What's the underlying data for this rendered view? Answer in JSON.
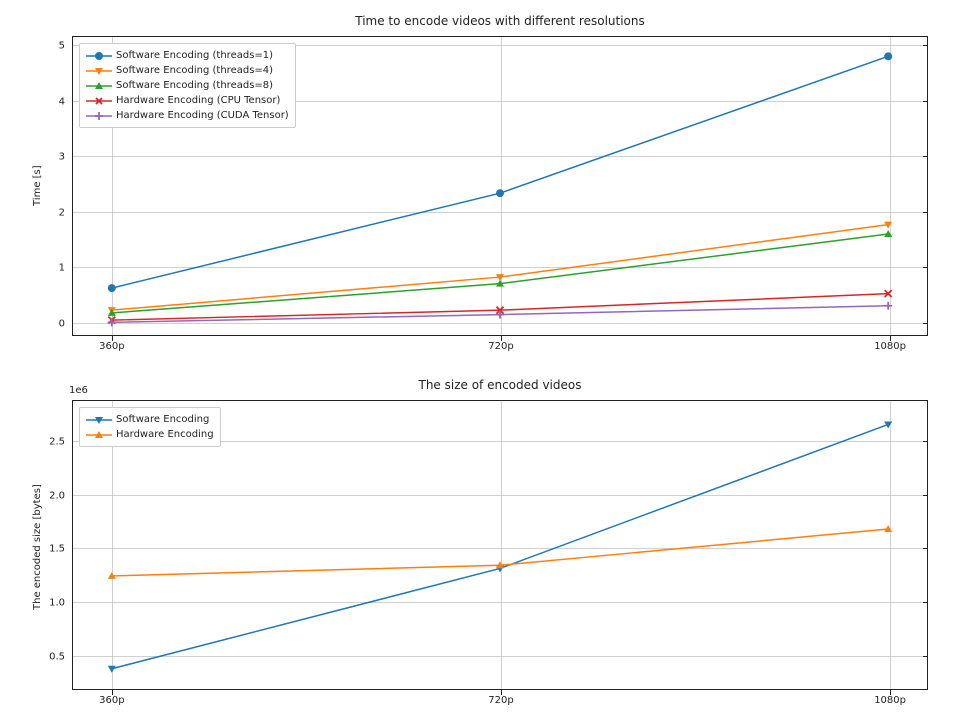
{
  "chart_data": [
    {
      "type": "line",
      "title": "Time to encode videos with different resolutions",
      "ylabel": "Time [s]",
      "xlabel": "",
      "categories": [
        "360p",
        "720p",
        "1080p"
      ],
      "ylim": [
        -0.2,
        5.2
      ],
      "yticks": [
        0,
        1,
        2,
        3,
        4,
        5
      ],
      "series": [
        {
          "name": "Software Encoding (threads=1)",
          "values": [
            0.65,
            2.37,
            4.85
          ],
          "color": "#1f77b4",
          "marker": "circle"
        },
        {
          "name": "Software Encoding (threads=4)",
          "values": [
            0.25,
            0.85,
            1.8
          ],
          "color": "#ff7f0e",
          "marker": "tri-down"
        },
        {
          "name": "Software Encoding (threads=8)",
          "values": [
            0.2,
            0.73,
            1.63
          ],
          "color": "#2ca02c",
          "marker": "tri-up"
        },
        {
          "name": "Hardware Encoding (CPU Tensor)",
          "values": [
            0.07,
            0.25,
            0.55
          ],
          "color": "#d62728",
          "marker": "x"
        },
        {
          "name": "Hardware Encoding (CUDA Tensor)",
          "values": [
            0.03,
            0.17,
            0.33
          ],
          "color": "#9467bd",
          "marker": "plus"
        }
      ]
    },
    {
      "type": "line",
      "title": "The size of encoded videos",
      "ylabel": "The encoded size [bytes]",
      "xlabel": "",
      "categories": [
        "360p",
        "720p",
        "1080p"
      ],
      "ylim": [
        200000,
        2900000
      ],
      "yticks": [
        500000,
        1000000,
        1500000,
        2000000,
        2500000
      ],
      "ytick_labels": [
        "0.5",
        "1.0",
        "1.5",
        "2.0",
        "2.5"
      ],
      "offset_text": "1e6",
      "series": [
        {
          "name": "Software Encoding",
          "values": [
            390000,
            1330000,
            2680000
          ],
          "color": "#1f77b4",
          "marker": "tri-down"
        },
        {
          "name": "Hardware Encoding",
          "values": [
            1260000,
            1360000,
            1700000
          ],
          "color": "#ff7f0e",
          "marker": "tri-up"
        }
      ]
    }
  ]
}
